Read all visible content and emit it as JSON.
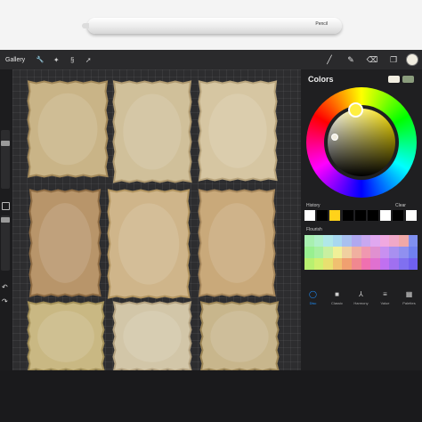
{
  "pencil": {
    "brand": " Pencil"
  },
  "topbar": {
    "gallery_label": "Gallery",
    "left_tools": [
      {
        "icon": "wrench-icon",
        "glyph": "🔧"
      },
      {
        "icon": "magic-wand-icon",
        "glyph": "✦"
      },
      {
        "icon": "selection-icon",
        "glyph": "§"
      },
      {
        "icon": "transform-arrow-icon",
        "glyph": "➚"
      }
    ],
    "right_tools": [
      {
        "icon": "brush-icon",
        "glyph": "╱"
      },
      {
        "icon": "smudge-icon",
        "glyph": "✎"
      },
      {
        "icon": "eraser-icon",
        "glyph": "⌫"
      },
      {
        "icon": "layers-icon",
        "glyph": "❐"
      }
    ],
    "active_color": "#f1ede0"
  },
  "colors_panel": {
    "title": "Colors",
    "primary_swatch": "#f1ede0",
    "secondary_swatch": "#8a9c7c",
    "history_label": "History",
    "clear_label": "Clear",
    "history": [
      "#ffffff",
      "#000000",
      "#ffd21a",
      "#000000",
      "#000000",
      "#000000",
      "#ffffff",
      "#000000",
      "#ffffff"
    ],
    "palette_label": "Flourish",
    "palette": [
      [
        "#a8f0b0",
        "#b0f0c8",
        "#b0e8e8",
        "#a8d8f0",
        "#a8c0f0",
        "#b0a8f0",
        "#c8a8f0",
        "#e0a8f0",
        "#f0a8e0",
        "#f0a8c8",
        "#f0a8a8",
        "#8090f0"
      ],
      [
        "#98f090",
        "#a8f0a0",
        "#c8f0a0",
        "#f0f098",
        "#f0d0a0",
        "#f0b0a0",
        "#f098b0",
        "#e090d0",
        "#c890f0",
        "#a890f0",
        "#9090f0",
        "#7080f0"
      ],
      [
        "#b8f070",
        "#d0f070",
        "#e8e070",
        "#f0c070",
        "#f0a070",
        "#f08890",
        "#f070b0",
        "#e070d0",
        "#c070f0",
        "#a070f0",
        "#8070f0",
        "#7060f0"
      ]
    ],
    "tabs": [
      {
        "label": "Disc",
        "icon": "disc-icon",
        "glyph": "◯",
        "active": true
      },
      {
        "label": "Classic",
        "icon": "classic-icon",
        "glyph": "■",
        "active": false
      },
      {
        "label": "Harmony",
        "icon": "harmony-icon",
        "glyph": "⅄",
        "active": false
      },
      {
        "label": "Value",
        "icon": "value-icon",
        "glyph": "≡",
        "active": false
      },
      {
        "label": "Palettes",
        "icon": "palettes-icon",
        "glyph": "▦",
        "active": false
      }
    ]
  },
  "papers": [
    {
      "name": "paper-1",
      "color": "#c9b487",
      "edge": "#a3895a"
    },
    {
      "name": "paper-2",
      "color": "#d0c09a",
      "edge": "#b09a70"
    },
    {
      "name": "paper-3",
      "color": "#d6c6a2",
      "edge": "#b8a47c"
    },
    {
      "name": "paper-4",
      "color": "#b8956a",
      "edge": "#8e6c44"
    },
    {
      "name": "paper-5",
      "color": "#cfb58a",
      "edge": "#b0935f"
    },
    {
      "name": "paper-6",
      "color": "#c9a97a",
      "edge": "#a4855a"
    },
    {
      "name": "paper-7",
      "color": "#c9b883",
      "edge": "#a39058"
    },
    {
      "name": "paper-8",
      "color": "#d2c6a8",
      "edge": "#b2a07e"
    },
    {
      "name": "paper-9",
      "color": "#c8b68c",
      "edge": "#9d8656"
    }
  ]
}
